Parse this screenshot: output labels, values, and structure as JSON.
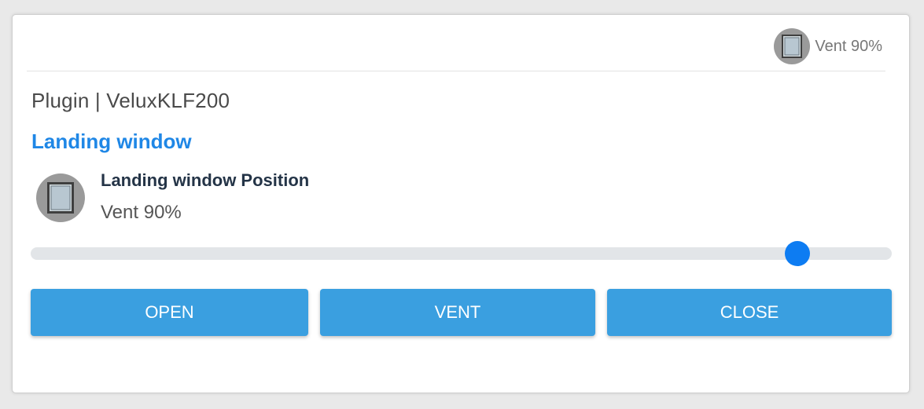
{
  "header": {
    "status_icon": "window-icon",
    "status_text": "Vent 90%"
  },
  "plugin_title": "Plugin | VeluxKLF200",
  "device": {
    "name": "Landing window",
    "item": {
      "icon": "window-icon",
      "title": "Landing window Position",
      "value": "Vent 90%"
    }
  },
  "slider": {
    "fraction": 0.89
  },
  "buttons": {
    "open_label": "OPEN",
    "vent_label": "VENT",
    "close_label": "CLOSE"
  },
  "colors": {
    "accent": "#1f87e6",
    "button": "#3a9fe0",
    "slider_thumb": "#0d7cf2"
  }
}
